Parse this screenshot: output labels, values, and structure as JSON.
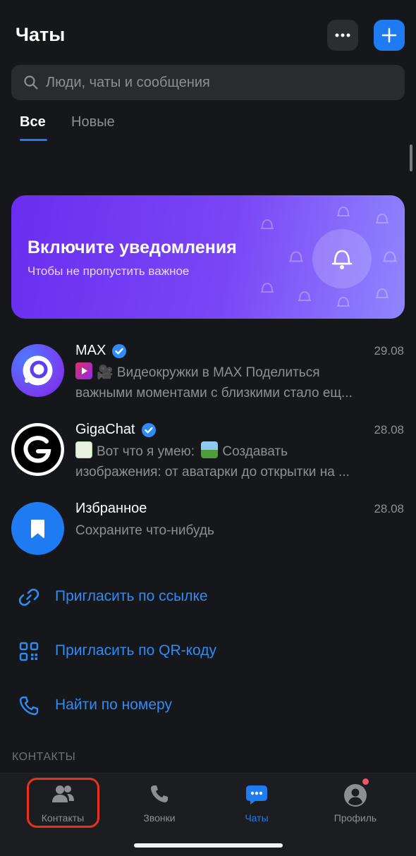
{
  "header": {
    "title": "Чаты",
    "more_icon": "ellipsis-icon",
    "add_icon": "plus-icon"
  },
  "search": {
    "placeholder": "Люди, чаты и сообщения",
    "icon": "search-icon"
  },
  "tabs": [
    {
      "label": "Все",
      "active": true
    },
    {
      "label": "Новые",
      "active": false
    }
  ],
  "banner": {
    "title": "Включите уведомления",
    "subtitle": "Чтобы не пропустить важное",
    "icon": "bell-icon"
  },
  "chats": [
    {
      "name": "MAX",
      "verified": true,
      "date": "29.08",
      "preview_line1": "🎥 Видеокружки в MAX Поделиться",
      "preview_line2": "важными моментами с близкими стало ещ..."
    },
    {
      "name": "GigaChat",
      "verified": true,
      "date": "28.08",
      "preview_line1": "Вот что я умею:",
      "preview_line1b": "Создавать",
      "preview_line2": "изображения: от аватарки до открытки на ..."
    },
    {
      "name": "Избранное",
      "verified": false,
      "date": "28.08",
      "preview_line1": "Сохраните что-нибудь"
    }
  ],
  "actions": [
    {
      "label": "Пригласить по ссылке",
      "icon": "link-icon"
    },
    {
      "label": "Пригласить по QR-коду",
      "icon": "qr-code-icon"
    },
    {
      "label": "Найти по номеру",
      "icon": "phone-icon"
    }
  ],
  "section": {
    "contacts_label": "КОНТАКТЫ"
  },
  "tabbar": [
    {
      "label": "Контакты",
      "icon": "contacts-icon",
      "active": false,
      "highlighted": true
    },
    {
      "label": "Звонки",
      "icon": "phone-icon",
      "active": false
    },
    {
      "label": "Чаты",
      "icon": "chat-bubble-icon",
      "active": true
    },
    {
      "label": "Профиль",
      "icon": "profile-icon",
      "active": false,
      "badge": true
    }
  ],
  "colors": {
    "background": "#16171b",
    "accent": "#1f7bf2",
    "link": "#2f8bf5",
    "banner_start": "#6a2ef0",
    "banner_end": "#8f86ff",
    "highlight_outline": "#e8321c"
  }
}
